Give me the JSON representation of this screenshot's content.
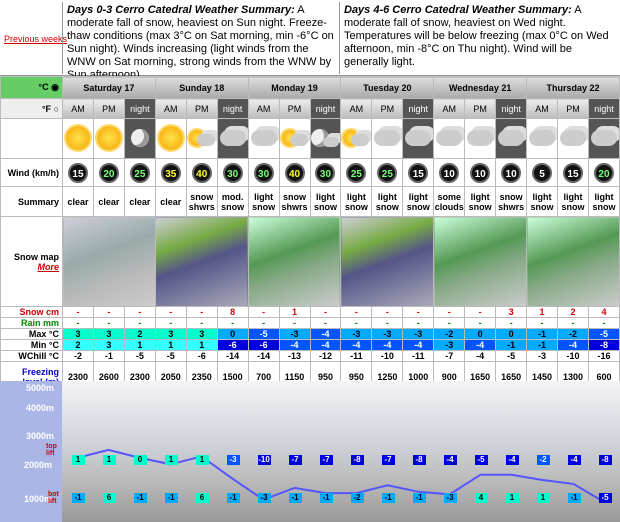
{
  "nav": {
    "previous_weeks": "Previous weeks"
  },
  "summary_left": {
    "title": "Days 0-3 Cerro Catedral Weather Summary:",
    "text": " A moderate fall of snow, heaviest on Sun night. Freeze-thaw conditions (max 3°C on Sat morning, min -6°C on Sun night). Winds increasing (light winds from the WNW on Sat morning, strong winds from the WNW by Sun afternoon)."
  },
  "summary_right": {
    "title": "Days 4-6 Cerro Catedral Weather Summary:",
    "text": " A moderate fall of snow, heaviest on Wed night. Temperatures will be below freezing (max 0°C on Wed afternoon, min -8°C on Thu night). Wind will be generally light."
  },
  "units": {
    "c": "°C",
    "f": "°F"
  },
  "days": [
    "Saturday 17",
    "Sunday 18",
    "Monday 19",
    "Tuesday 20",
    "Wednesday 21",
    "Thursday 22"
  ],
  "periods": [
    "AM",
    "PM",
    "night",
    "AM",
    "PM",
    "night",
    "AM",
    "PM",
    "night",
    "AM",
    "PM",
    "night",
    "AM",
    "PM",
    "night",
    "AM",
    "PM",
    "night"
  ],
  "labels": {
    "wind": "Wind (km/h)",
    "summary": "Summary",
    "snowmap": "Snow map",
    "more": "More",
    "snow": "Snow cm",
    "rain": "Rain mm",
    "max": "Max °C",
    "min": "Min °C",
    "wchill": "WChill °C",
    "freezing": "Freezing level (m)"
  },
  "weather_icons": [
    "sun",
    "sun",
    "moon",
    "sun",
    "sun-cloud",
    "cloud",
    "cloud",
    "sun-cloud",
    "moon-cloud",
    "sun-cloud",
    "cloud",
    "cloud",
    "cloud-snow",
    "cloud",
    "cloud",
    "cloud",
    "cloud",
    "cloud"
  ],
  "wind": [
    "15",
    "20",
    "25",
    "35",
    "40",
    "30",
    "30",
    "40",
    "30",
    "25",
    "25",
    "15",
    "10",
    "10",
    "10",
    "5",
    "15",
    "20"
  ],
  "summary": [
    "clear",
    "clear",
    "clear",
    "clear",
    "snow shwrs",
    "mod. snow",
    "light snow",
    "snow shwrs",
    "light snow",
    "light snow",
    "light snow",
    "light snow",
    "some clouds",
    "light snow",
    "snow shwrs",
    "light snow",
    "light snow",
    "light snow"
  ],
  "snow": [
    "-",
    "-",
    "-",
    "-",
    "-",
    "8",
    "-",
    "1",
    "-",
    "-",
    "-",
    "-",
    "-",
    "-",
    "3",
    "1",
    "2",
    "4"
  ],
  "rain": [
    "-",
    "-",
    "-",
    "-",
    "-",
    "-",
    "-",
    "-",
    "-",
    "-",
    "-",
    "-",
    "-",
    "-",
    "-",
    "-",
    "-",
    "-"
  ],
  "max": [
    "3",
    "3",
    "2",
    "3",
    "3",
    "0",
    "-5",
    "-3",
    "-4",
    "-3",
    "-3",
    "-3",
    "-2",
    "0",
    "0",
    "-1",
    "-2",
    "-5"
  ],
  "min": [
    "2",
    "3",
    "1",
    "1",
    "1",
    "-6",
    "-6",
    "-4",
    "-4",
    "-4",
    "-4",
    "-4",
    "-3",
    "-4",
    "-1",
    "-1",
    "-4",
    "-8"
  ],
  "wchill": [
    "-2",
    "-1",
    "-5",
    "-5",
    "-6",
    "-14",
    "-14",
    "-13",
    "-12",
    "-11",
    "-10",
    "-11",
    "-7",
    "-4",
    "-5",
    "-3",
    "-10",
    "-16"
  ],
  "freezing": [
    "2300",
    "2600",
    "2300",
    "2050",
    "2350",
    "1500",
    "700",
    "1150",
    "950",
    "950",
    "1250",
    "1000",
    "900",
    "1650",
    "1650",
    "1450",
    "1300",
    "600"
  ],
  "chart": {
    "y_labels": [
      "5000m",
      "4000m",
      "3000m",
      "2000m",
      "1000m"
    ],
    "top_lift": "top lift",
    "bot_lift": "bot lift",
    "top_vals": [
      "1",
      "1",
      "0",
      "1",
      "1",
      "-3",
      "-10",
      "-7",
      "-7",
      "-8",
      "-7",
      "-8",
      "-4",
      "-5",
      "-4",
      "-2",
      "-4",
      "-8"
    ],
    "bot_vals": [
      "-1",
      "6",
      "-1",
      "-1",
      "6",
      "-1",
      "-3",
      "-1",
      "-1",
      "-2",
      "-1",
      "-1",
      "-3",
      "4",
      "1",
      "1",
      "-1",
      "-5"
    ]
  }
}
